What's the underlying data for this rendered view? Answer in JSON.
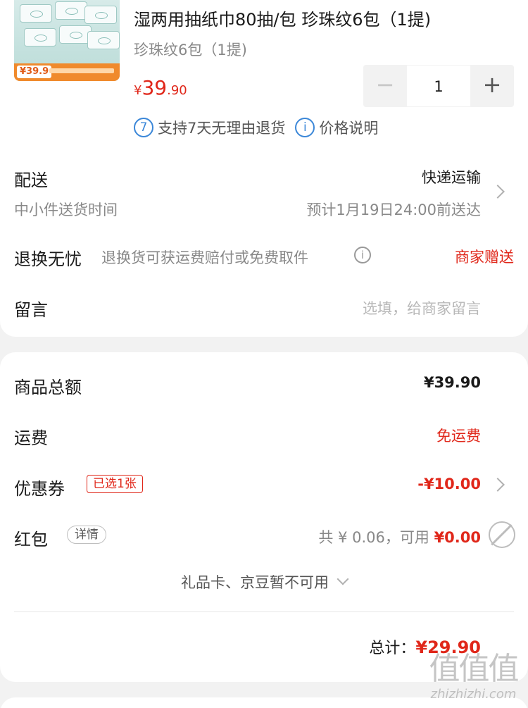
{
  "product": {
    "title": "湿两用抽纸巾80抽/包 珍珠纹6包（1提)",
    "spec": "珍珠纹6包（1提)",
    "image_badge_price": "¥39.9",
    "price_currency": "¥",
    "price_integer": "39",
    "price_decimal": ".90",
    "quantity": "1",
    "minus_label": "−",
    "plus_label": "+"
  },
  "service": {
    "return_badge": "7",
    "return_text": "支持7天无理由退货",
    "price_info_icon": "i",
    "price_info_text": "价格说明"
  },
  "delivery": {
    "label": "配送",
    "method": "快递运输",
    "sub_label": "中小件送货时间",
    "eta": "预计1月19日24:00前送达"
  },
  "return_worry_free": {
    "label": "退换无忧",
    "desc": "退换货可获运费赔付或免费取件",
    "info_icon": "i",
    "value": "商家赠送"
  },
  "message": {
    "label": "留言",
    "placeholder": "选填，给商家留言"
  },
  "summary": {
    "goods_total_label": "商品总额",
    "goods_total_value": "¥39.90",
    "shipping_label": "运费",
    "shipping_value": "免运费",
    "coupon_label": "优惠券",
    "coupon_tag": "已选1张",
    "coupon_value": "-¥10.00",
    "redpacket_label": "红包",
    "redpacket_detail": "详情",
    "redpacket_total": "共 ¥ 0.06，可用",
    "redpacket_available": "¥0.00",
    "giftcard_text": "礼品卡、京豆暂不可用",
    "total_label": "总计：",
    "total_value": "¥29.90"
  },
  "watermark": {
    "logo": "值值值",
    "site": "zhizhizhi.com"
  },
  "colors": {
    "accent_red": "#e0271a",
    "info_blue": "#3b87d8",
    "background": "#f2f2f2"
  }
}
